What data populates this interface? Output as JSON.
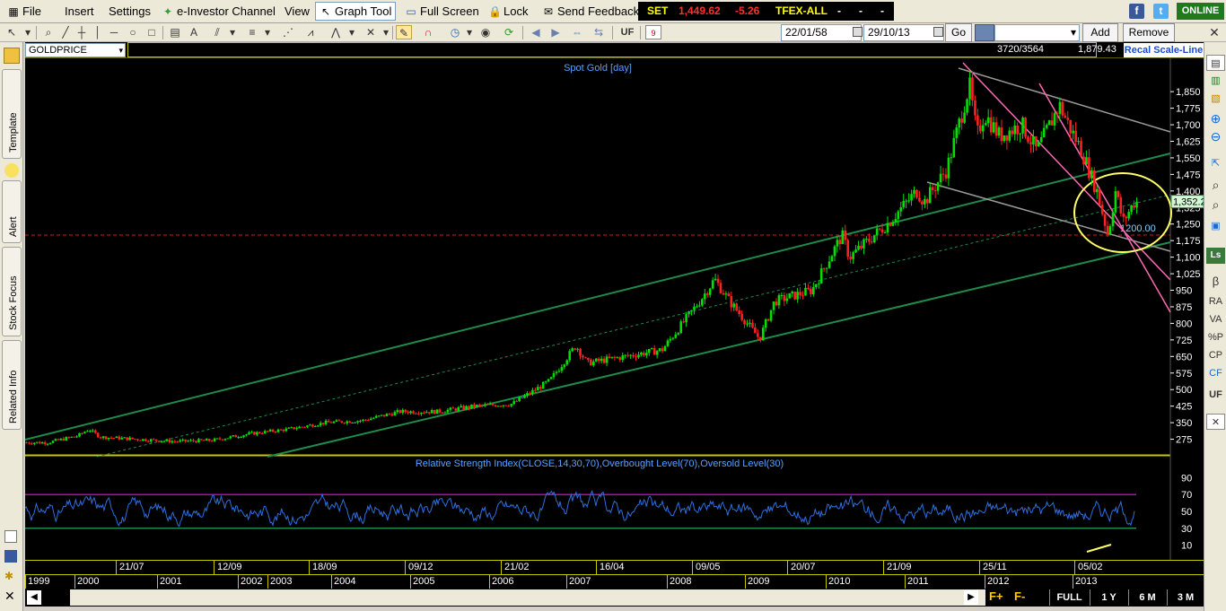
{
  "menu": {
    "file": "File",
    "insert": "Insert",
    "settings": "Settings",
    "channel": "e-Investor Channel",
    "view": "View",
    "graph_tool": "Graph Tool",
    "full_screen": "Full Screen",
    "lock": "Lock",
    "feedback": "Send Feedback"
  },
  "ticker": {
    "set_label": "SET",
    "set_value": "1,449.62",
    "set_change": "-5.26",
    "tfex_label": "TFEX-ALL",
    "tfex_v1": "-",
    "tfex_v2": "-",
    "tfex_v3": "-"
  },
  "status": {
    "online": "ONLINE"
  },
  "social": {
    "facebook": "f",
    "twitter": "t"
  },
  "toolbar": {
    "uf": "UF",
    "calendar_day": "9",
    "date_from": "22/01/58",
    "date_to": "29/10/13",
    "go": "Go",
    "add": "Add",
    "remove": "Remove"
  },
  "chart_header": {
    "symbol": "GOLDPRICE",
    "bar_count": "3720/3564",
    "last_price": "1,879.43",
    "recal": "Recal Scale-Line"
  },
  "left_tabs": {
    "template": "Template",
    "alert": "Alert",
    "stock_focus": "Stock Focus",
    "related": "Related Info"
  },
  "right_tools": {
    "beta": "β",
    "ra": "RA",
    "va": "VA",
    "pct_p": "%P",
    "cp": "CP",
    "cf": "CF",
    "uf": "UF",
    "ls": "Ls"
  },
  "chart_data": [
    {
      "type": "candlestick",
      "title": "Spot Gold [day]",
      "y_ticks": [
        275,
        350,
        425,
        500,
        575,
        650,
        725,
        800,
        875,
        950,
        1025,
        1100,
        1175,
        1250,
        1325,
        1400,
        1475,
        1550,
        1625,
        1700,
        1775,
        1850
      ],
      "y_tick_labels": [
        "275",
        "350",
        "425",
        "500",
        "575",
        "650",
        "725",
        "800",
        "875",
        "950",
        "1,025",
        "1,100",
        "1,175",
        "1,250",
        "1,325",
        "1,400",
        "1,475",
        "1,550",
        "1,625",
        "1,700",
        "1,775",
        "1,850"
      ],
      "ylim": [
        200,
        1940
      ],
      "current_price_label": "1,352.2",
      "support_level": 1200,
      "support_label": "1200.00",
      "x_range": [
        "1999",
        "2013-10"
      ],
      "series": [
        {
          "x": [
            1999.3,
            1999.7,
            1999.85,
            2000.0,
            2000.5,
            2001.0,
            2001.5,
            2002.0,
            2002.5,
            2003.0,
            2003.5,
            2004.0,
            2004.5,
            2005.0,
            2005.5,
            2006.0,
            2006.35,
            2006.5,
            2007.0,
            2007.5,
            2008.0,
            2008.2,
            2008.4,
            2008.8,
            2009.0,
            2009.5,
            2009.9,
            2010.0,
            2010.5,
            2010.9,
            2011.0,
            2011.3,
            2011.6,
            2011.7,
            2011.8,
            2012.0,
            2012.3,
            2012.5,
            2012.8,
            2012.95,
            2013.1,
            2013.3,
            2013.45,
            2013.55,
            2013.65,
            2013.8
          ],
          "values": [
            260,
            290,
            320,
            285,
            275,
            265,
            270,
            300,
            320,
            350,
            360,
            400,
            400,
            425,
            435,
            540,
            700,
            620,
            650,
            680,
            900,
            1000,
            900,
            730,
            900,
            950,
            1200,
            1100,
            1250,
            1400,
            1350,
            1500,
            1880,
            1650,
            1750,
            1650,
            1700,
            1580,
            1790,
            1680,
            1580,
            1400,
            1200,
            1400,
            1260,
            1350
          ]
        }
      ],
      "annotations": [
        "green regression channel (upper, middle dashed, lower)",
        "gray descending channel",
        "pink descending channel",
        "yellow ellipse around 2013 low"
      ]
    },
    {
      "type": "line",
      "title": "Relative Strength Index(CLOSE,14,30,70),Overbought Level(70),Oversold Level(30)",
      "y_ticks": [
        10,
        30,
        50,
        70,
        90
      ],
      "ylim": [
        0,
        100
      ],
      "overbought": 70,
      "oversold": 30
    }
  ],
  "x_axis": {
    "months": [
      "21/07",
      "12/09",
      "18/09",
      "09/12",
      "21/02",
      "16/04",
      "09/05",
      "20/07",
      "21/09",
      "25/11",
      "05/02"
    ],
    "years": [
      "1999",
      "2000",
      "2001",
      "2002",
      "2003",
      "2004",
      "2005",
      "2006",
      "2007",
      "2008",
      "2009",
      "2010",
      "2011",
      "2012",
      "2013"
    ]
  },
  "periods": {
    "full": "FULL",
    "y1": "1 Y",
    "m6": "6 M",
    "m3": "3 M"
  },
  "colors": {
    "up": "#00e000",
    "down": "#ff2020",
    "channel_green": "#1e8c4a",
    "gray": "#9a9a9a",
    "pink": "#ff69b4",
    "yellow": "#ffff66",
    "rsi_line": "#2f6fe0",
    "overbought_line": "#c000c0",
    "oversold_line": "#1e8c4a",
    "axis_text": "#ffffff",
    "title_text": "#5aa0ff"
  }
}
